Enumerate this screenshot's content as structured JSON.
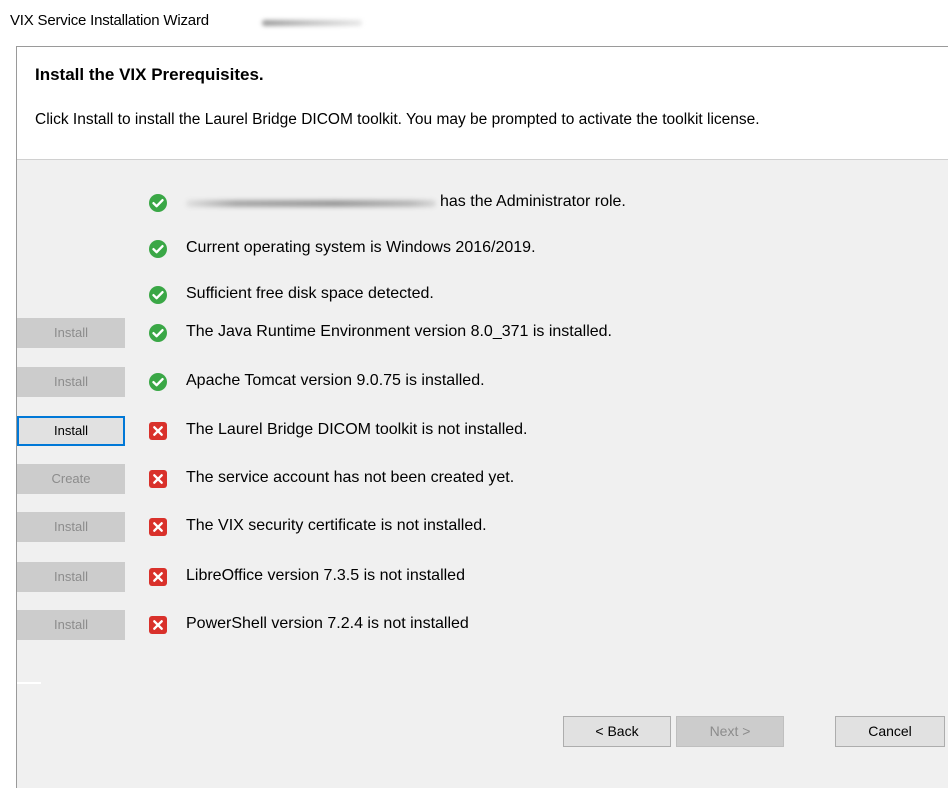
{
  "window": {
    "title": "VIX Service Installation Wizard"
  },
  "header": {
    "title": "Install the VIX Prerequisites.",
    "description": "Click Install to install the Laurel Bridge DICOM toolkit. You may be prompted to activate the toolkit license."
  },
  "checks": [
    {
      "button": "",
      "status": "ok",
      "text": "has the Administrator role."
    },
    {
      "button": "",
      "status": "ok",
      "text": "Current operating system is Windows 2016/2019."
    },
    {
      "button": "",
      "status": "ok",
      "text": "Sufficient free disk space detected."
    },
    {
      "button": "Install",
      "status": "ok",
      "text": "The Java Runtime Environment version 8.0_371 is installed."
    },
    {
      "button": "Install",
      "status": "ok",
      "text": "Apache Tomcat version 9.0.75 is installed."
    },
    {
      "button": "Install",
      "status": "error",
      "text": "The Laurel Bridge DICOM toolkit is not installed."
    },
    {
      "button": "Create",
      "status": "error",
      "text": "The service account has not been created yet."
    },
    {
      "button": "Install",
      "status": "error",
      "text": "The VIX security certificate is not installed."
    },
    {
      "button": "Install",
      "status": "error",
      "text": "LibreOffice version 7.3.5 is not installed"
    },
    {
      "button": "Install",
      "status": "error",
      "text": "PowerShell version 7.2.4 is not installed"
    }
  ],
  "footer": {
    "back_label": "< Back",
    "next_label": "Next >",
    "cancel_label": "Cancel"
  },
  "colors": {
    "ok": "#3aa746",
    "error": "#d9312b",
    "focus": "#0078d7"
  },
  "icons": {
    "ok": "check-circle-icon",
    "error": "x-square-icon"
  }
}
